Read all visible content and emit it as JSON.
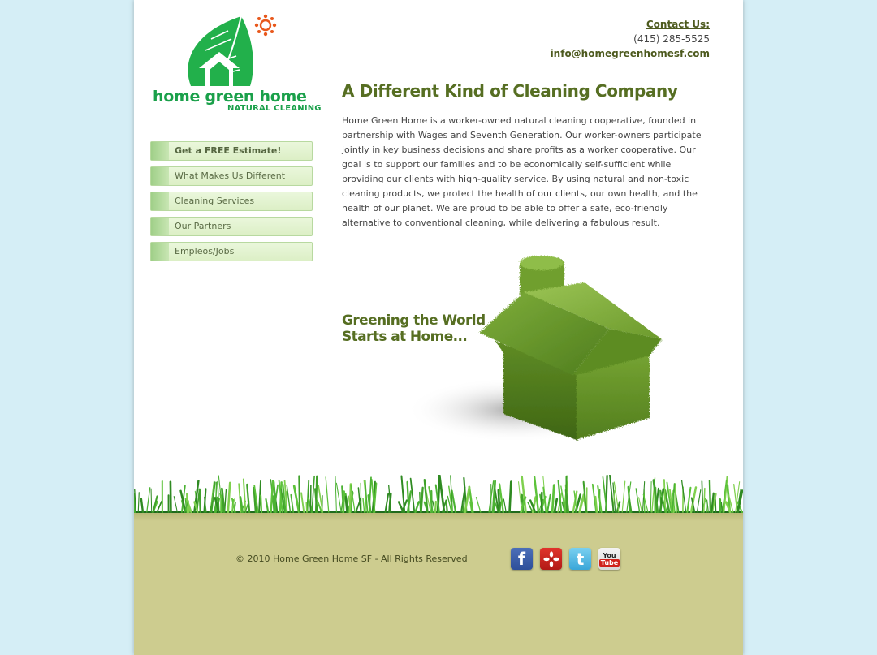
{
  "logo": {
    "name": "home green home",
    "subtitle": "NATURAL CLEANING"
  },
  "contact": {
    "label": "Contact Us:",
    "phone": "(415) 285-5525",
    "email": "info@homegreenhomesf.com"
  },
  "nav": {
    "items": [
      {
        "label": "Get a FREE Estimate!"
      },
      {
        "label": "What Makes Us Different"
      },
      {
        "label": "Cleaning Services"
      },
      {
        "label": "Our Partners"
      },
      {
        "label": "Empleos/Jobs"
      }
    ]
  },
  "main": {
    "heading": "A Different Kind of Cleaning Company",
    "body": "Home Green Home is a worker-owned natural cleaning cooperative, founded in partnership with Wages and Seventh Generation. Our worker-owners participate jointly in key business decisions and share profits as a worker cooperative. Our goal is to support our families and to be economically self-sufficient while providing our clients with high-quality service. By using natural and non-toxic cleaning products, we protect the health of our clients, our own health, and the health of our planet. We are proud to be able to offer a safe, eco-friendly alternative to conventional cleaning, while delivering a fabulous result.",
    "tagline_line1": "Greening the World",
    "tagline_line2": "Starts at Home..."
  },
  "footer": {
    "copyright": "© 2010 Home Green Home SF - All Rights Reserved",
    "social": [
      {
        "name": "facebook-icon",
        "glyph": "f"
      },
      {
        "name": "yelp-icon",
        "glyph": "✿"
      },
      {
        "name": "twitter-icon",
        "glyph": "t"
      },
      {
        "name": "youtube-icon",
        "glyph_top": "You",
        "glyph_bottom": "Tube"
      }
    ]
  },
  "colors": {
    "background": "#d5eef6",
    "brand_green": "#1aa04a",
    "heading_olive": "#566e22",
    "footer_khaki": "#cdcc8f"
  }
}
